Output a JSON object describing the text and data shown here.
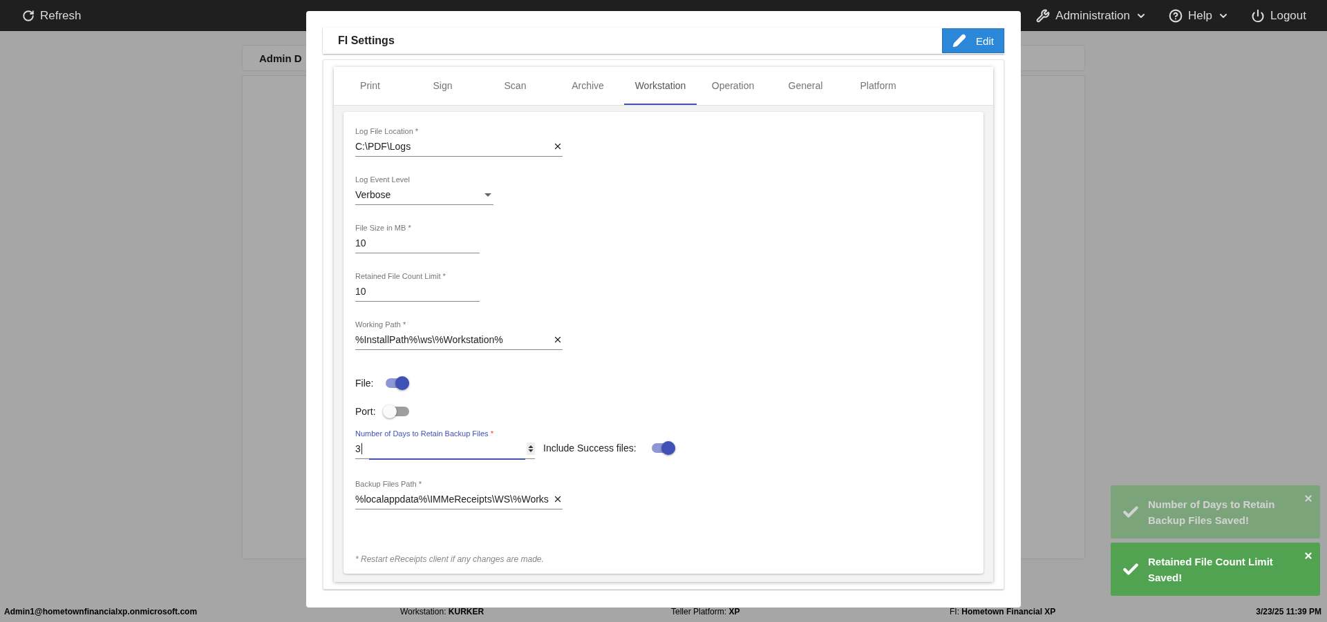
{
  "top_bar": {
    "refresh": "Refresh",
    "menus": [
      {
        "label": "Administration",
        "kind": "dropdown"
      },
      {
        "label": "Help",
        "kind": "dropdown"
      },
      {
        "label": "Logout",
        "kind": "plain"
      }
    ]
  },
  "background": {
    "tab": "Admin D"
  },
  "dialog": {
    "title": "FI Settings",
    "edit_button": "Edit",
    "tabs": [
      {
        "label": "Print",
        "selected": false
      },
      {
        "label": "Sign",
        "selected": false
      },
      {
        "label": "Scan",
        "selected": false
      },
      {
        "label": "Archive",
        "selected": false
      },
      {
        "label": "Workstation",
        "selected": true
      },
      {
        "label": "Operation",
        "selected": false
      },
      {
        "label": "General",
        "selected": false
      },
      {
        "label": "Platform",
        "selected": false
      }
    ],
    "fields": [
      {
        "kind": "text",
        "label": "Log File Location *",
        "value": "C:\\PDF\\Logs",
        "clearable": true
      },
      {
        "kind": "select",
        "label": "Log Event Level",
        "value": "Verbose"
      },
      {
        "kind": "text",
        "label": "File Size in MB *",
        "value": "10",
        "clearable": false
      },
      {
        "kind": "text",
        "label": "Retained File Count Limit *",
        "value": "10",
        "clearable": false
      },
      {
        "kind": "text",
        "label": "Working Path *",
        "value": "%InstallPath%\\ws\\%Workstation%",
        "clearable": true
      },
      {
        "kind": "toggle",
        "label": "File:",
        "on": true
      },
      {
        "kind": "toggle",
        "label": "Port:",
        "on": false
      },
      {
        "kind": "number",
        "label": "Number of Days to Retain Backup Files",
        "required_mark": "*",
        "value": "3",
        "focused": true,
        "toggle": {
          "label": "Include Success files:",
          "on": true
        }
      },
      {
        "kind": "text",
        "label": "Backup Files Path *",
        "value": "%localappdata%\\IMMeReceipts\\WS\\%Works",
        "clearable": true
      }
    ],
    "note": "* Restart eReceipts client if any changes are made."
  },
  "toasts": [
    {
      "message": "Number of Days to Retain Backup Files Saved!",
      "faded": true
    },
    {
      "message": "Retained File Count Limit Saved!",
      "faded": false
    }
  ],
  "status_bar": {
    "user": "Admin1@hometownfinancialxp.onmicrosoft.com",
    "items": [
      {
        "label": "Workstation:",
        "value": "KURKER"
      },
      {
        "label": "Teller Platform:",
        "value": "XP"
      },
      {
        "label": "FI:",
        "value": "Hometown Financial XP"
      }
    ],
    "datetime": "3/23/25 11:39 PM"
  }
}
